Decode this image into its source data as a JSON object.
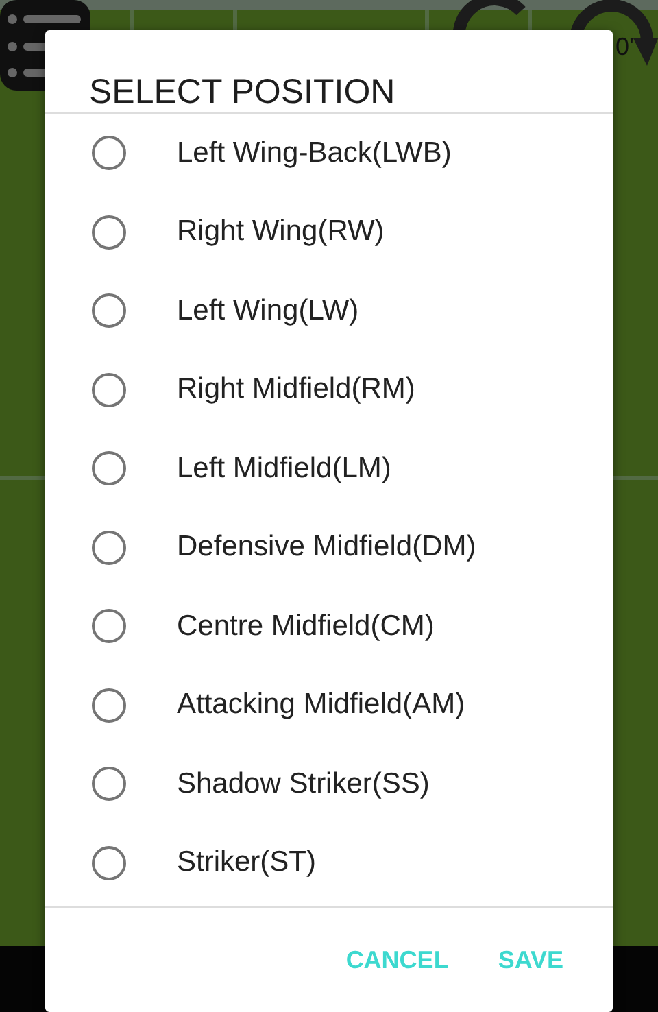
{
  "background": {
    "timer": "0'"
  },
  "dialog": {
    "title": "SELECT POSITION",
    "options": [
      {
        "label": "Left Wing-Back(LWB)",
        "selected": false
      },
      {
        "label": "Right Wing(RW)",
        "selected": false
      },
      {
        "label": "Left Wing(LW)",
        "selected": false
      },
      {
        "label": "Right Midfield(RM)",
        "selected": false
      },
      {
        "label": "Left Midfield(LM)",
        "selected": false
      },
      {
        "label": "Defensive Midfield(DM)",
        "selected": false
      },
      {
        "label": "Centre Midfield(CM)",
        "selected": false
      },
      {
        "label": "Attacking Midfield(AM)",
        "selected": false
      },
      {
        "label": "Shadow Striker(SS)",
        "selected": false
      },
      {
        "label": "Striker(ST)",
        "selected": false
      }
    ],
    "buttons": [
      "CANCEL",
      "SAVE"
    ]
  }
}
